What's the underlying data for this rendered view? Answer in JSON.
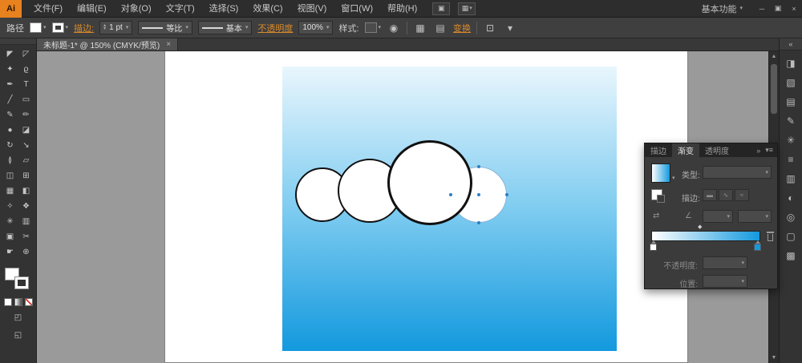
{
  "colors": {
    "accent_orange": "#d98a2b",
    "gradient_top": "#e9f6fd",
    "gradient_mid": "#7fccf0",
    "gradient_bottom": "#1399de",
    "selection_blue": "#2e7fc2"
  },
  "icons": {
    "chevron_down": "▾",
    "stepper_up": "▴",
    "stepper_down": "▾",
    "doc_icon": "▣",
    "layout_icon": "▦",
    "recolor_artwork": "◉",
    "align_h": "▦",
    "align_v": "▤",
    "isolate": "⊡",
    "more_options": "▾",
    "scroll_up": "▲",
    "scroll_down": "▼",
    "reverse_gradient": "⇄",
    "angle": "∠",
    "midpoint": "◆"
  },
  "titlebar": {
    "logo": "Ai",
    "menus": [
      "文件(F)",
      "编辑(E)",
      "对象(O)",
      "文字(T)",
      "选择(S)",
      "效果(C)",
      "视图(V)",
      "窗口(W)",
      "帮助(H)"
    ],
    "workspace": "基本功能",
    "minimize_icon": "─",
    "restore_icon": "▣",
    "close_icon": "×"
  },
  "control_bar": {
    "object_label": "路径",
    "stroke_link": "描边:",
    "stroke_width": "1 pt",
    "width_profile": "等比",
    "brush_name": "基本",
    "opacity_link": "不透明度",
    "opacity_value": "100%",
    "style_label": "样式:",
    "transform_link": "变换"
  },
  "doc_tab": {
    "title": "未标题-1* @ 150% (CMYK/预览)",
    "close_icon": "×"
  },
  "tools": [
    {
      "name": "selection-tool",
      "glyph": "◤"
    },
    {
      "name": "direct-selection-tool",
      "glyph": "◸"
    },
    {
      "name": "magic-wand-tool",
      "glyph": "✦"
    },
    {
      "name": "lasso-tool",
      "glyph": "ϱ"
    },
    {
      "name": "pen-tool",
      "glyph": "✒"
    },
    {
      "name": "type-tool",
      "glyph": "T"
    },
    {
      "name": "line-segment-tool",
      "glyph": "╱"
    },
    {
      "name": "rectangle-tool",
      "glyph": "▭"
    },
    {
      "name": "paintbrush-tool",
      "glyph": "✎"
    },
    {
      "name": "pencil-tool",
      "glyph": "✏"
    },
    {
      "name": "blob-brush-tool",
      "glyph": "●"
    },
    {
      "name": "eraser-tool",
      "glyph": "◪"
    },
    {
      "name": "rotate-tool",
      "glyph": "↻"
    },
    {
      "name": "scale-tool",
      "glyph": "↘"
    },
    {
      "name": "width-tool",
      "glyph": "≬"
    },
    {
      "name": "free-transform-tool",
      "glyph": "▱"
    },
    {
      "name": "shape-builder-tool",
      "glyph": "◫"
    },
    {
      "name": "perspective-grid-tool",
      "glyph": "⊞"
    },
    {
      "name": "mesh-tool",
      "glyph": "▦"
    },
    {
      "name": "gradient-tool",
      "glyph": "◧"
    },
    {
      "name": "eyedropper-tool",
      "glyph": "✧"
    },
    {
      "name": "blend-tool",
      "glyph": "❖"
    },
    {
      "name": "symbol-sprayer-tool",
      "glyph": "✳"
    },
    {
      "name": "column-graph-tool",
      "glyph": "▥"
    },
    {
      "name": "artboard-tool",
      "glyph": "▣"
    },
    {
      "name": "slice-tool",
      "glyph": "✂"
    },
    {
      "name": "hand-tool",
      "glyph": "☛"
    },
    {
      "name": "zoom-tool",
      "glyph": "⊕"
    }
  ],
  "dock": {
    "collapse_icon": "«",
    "icons": [
      {
        "name": "color-panel-icon",
        "glyph": "◨"
      },
      {
        "name": "color-guide-panel-icon",
        "glyph": "▧"
      },
      {
        "name": "swatches-panel-icon",
        "glyph": "▤"
      },
      {
        "name": "brushes-panel-icon",
        "glyph": "✎"
      },
      {
        "name": "symbols-panel-icon",
        "glyph": "✳"
      },
      {
        "name": "stroke-panel-icon",
        "glyph": "≡"
      },
      {
        "name": "gradient-panel-icon",
        "glyph": "▥"
      },
      {
        "name": "transparency-panel-icon",
        "glyph": "◐"
      },
      {
        "name": "appearance-panel-icon",
        "glyph": "◎"
      },
      {
        "name": "graphic-styles-panel-icon",
        "glyph": "▢"
      },
      {
        "name": "layers-panel-icon",
        "glyph": "▩"
      }
    ]
  },
  "gradient_panel": {
    "tabs": [
      {
        "label": "描边",
        "name": "tab-stroke",
        "active": false
      },
      {
        "label": "渐变",
        "name": "tab-gradient",
        "active": true
      },
      {
        "label": "透明度",
        "name": "tab-transparency",
        "active": false
      }
    ],
    "overflow_icon": "»",
    "menu_icon": "▾≡",
    "type_label": "类型:",
    "type_value": "",
    "stroke_label": "描边:",
    "stroke_buttons": [
      {
        "name": "gradient-within-stroke-icon",
        "glyph": "▬"
      },
      {
        "name": "gradient-along-stroke-icon",
        "glyph": "∿"
      },
      {
        "name": "gradient-across-stroke-icon",
        "glyph": "≈"
      }
    ],
    "opacity_label": "不透明度:",
    "location_label": "位置:"
  }
}
